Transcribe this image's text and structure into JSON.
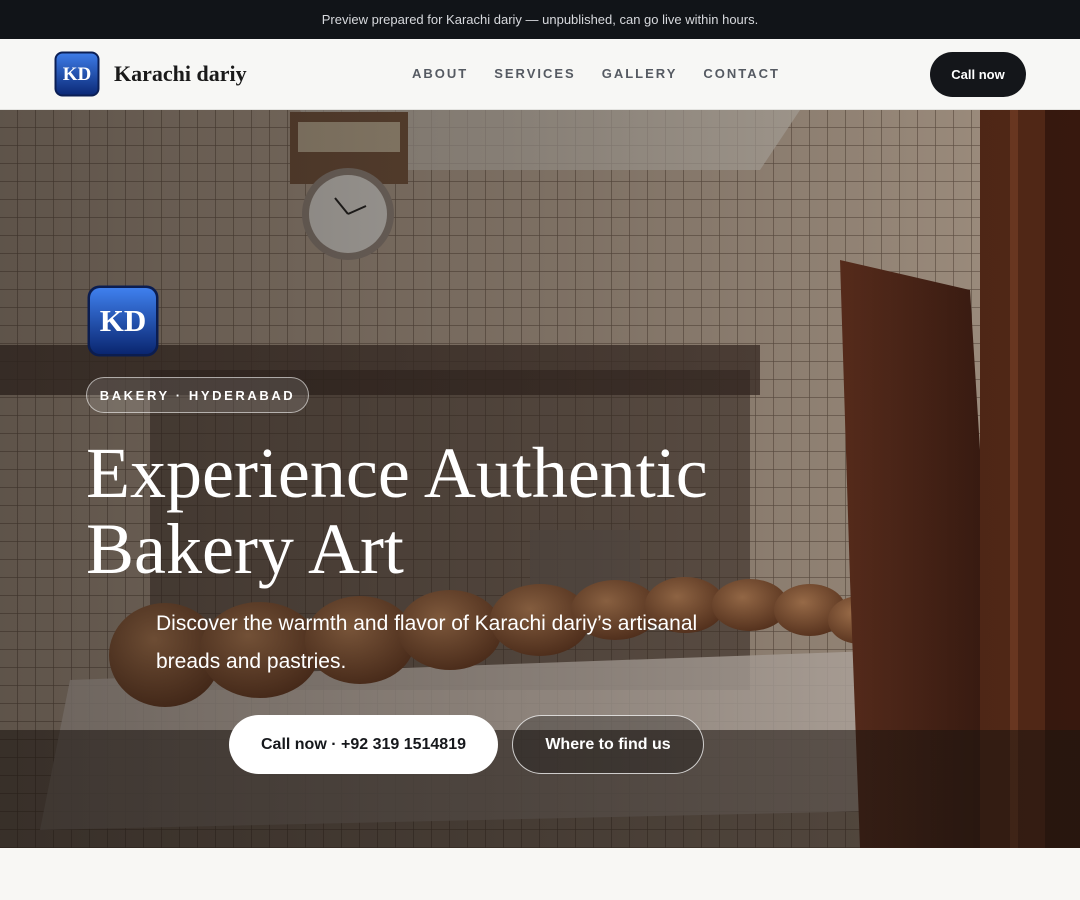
{
  "banner": {
    "text": "Preview prepared for Karachi dariy — unpublished, can go live within hours."
  },
  "brand": {
    "logo_text": "KD",
    "name": "Karachi dariy"
  },
  "nav": {
    "links": [
      "ABOUT",
      "SERVICES",
      "GALLERY",
      "CONTACT"
    ],
    "cta": "Call now"
  },
  "hero": {
    "tag": "BAKERY · HYDERABAD",
    "title_line1": "Experience Authentic",
    "title_line2": "Bakery Art",
    "subtitle": "Discover the warmth and flavor of Karachi dariy’s artisanal breads and pastries.",
    "primary_button": "Call now · +92 319 1514819",
    "secondary_button": "Where to find us"
  },
  "colors": {
    "banner_bg": "#111418",
    "nav_bg": "#f7f7f5",
    "cta_bg": "#14161a",
    "logo_blue": "#1f4fbf"
  }
}
